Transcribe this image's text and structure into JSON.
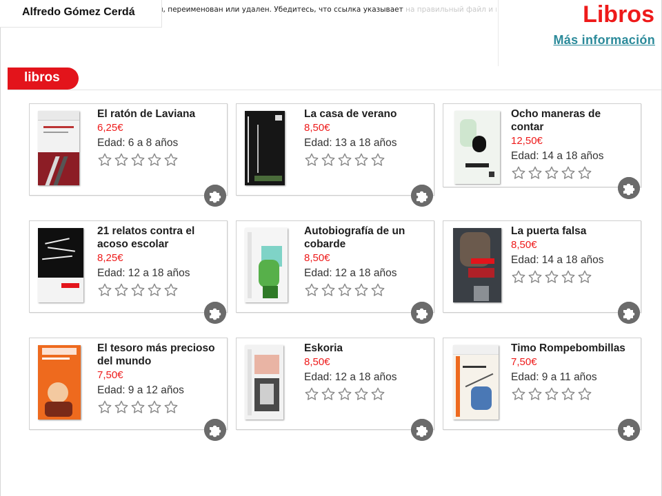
{
  "header": {
    "author": "Alfredo Gómez Cerdá",
    "error_text": ". Возможно, этот файл был перемещен, переименован или удален. Убедитесь, что ссылка указывает",
    "error_tail": "на правильный файл и папку",
    "title": "Libros",
    "more_link": "Más información"
  },
  "section": {
    "label": "libros"
  },
  "icons": {
    "star": "star-outline-icon",
    "puzzle": "puzzle-icon",
    "broken_image": "broken-image-icon"
  },
  "colors": {
    "accent": "#ee1a1a",
    "tab": "#e3141b",
    "link": "#2b8a9a",
    "price": "#ee1a1a",
    "puzzle": "#6b6b6b"
  },
  "books": [
    {
      "title": "El ratón de Laviana",
      "price": "6,25€",
      "age": "Edad: 6 a 8 años",
      "rating": 0
    },
    {
      "title": "La casa de verano",
      "price": "8,50€",
      "age": "Edad: 13 a 18 años",
      "rating": 0
    },
    {
      "title": "Ocho maneras de contar",
      "price": "12,50€",
      "age": "Edad: 14 a 18 años",
      "rating": 0
    },
    {
      "title": "21 relatos contra el acoso escolar",
      "price": "8,25€",
      "age": "Edad: 12 a 18 años",
      "rating": 0
    },
    {
      "title": "Autobiografía de un cobarde",
      "price": "8,50€",
      "age": "Edad: 12 a 18 años",
      "rating": 0
    },
    {
      "title": "La puerta falsa",
      "price": "8,50€",
      "age": "Edad: 14 a 18 años",
      "rating": 0
    },
    {
      "title": "El tesoro más precioso del mundo",
      "price": "7,50€",
      "age": "Edad: 9 a 12 años",
      "rating": 0
    },
    {
      "title": "Eskoria",
      "price": "8,50€",
      "age": "Edad: 12 a 18 años",
      "rating": 0
    },
    {
      "title": "Timo Rompebombillas",
      "price": "7,50€",
      "age": "Edad: 9 a 11 años",
      "rating": 0
    }
  ]
}
